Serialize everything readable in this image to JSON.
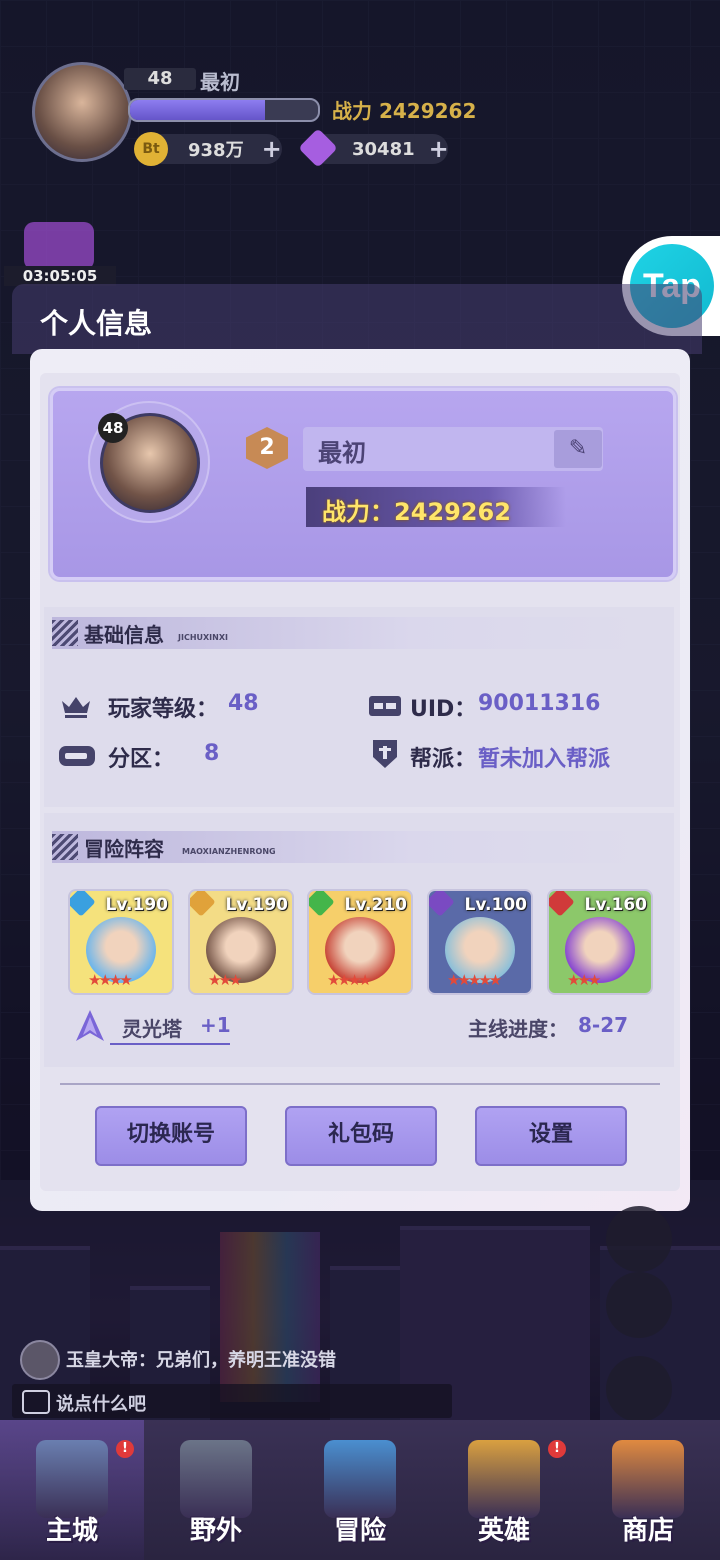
{
  "hud": {
    "level": "48",
    "player_name": "最初",
    "power": "战力 2429262",
    "xp_fraction": 0.72,
    "gold_amount": "938万",
    "gold_icon_text": "Bt",
    "gem_amount": "30481",
    "plus": "+",
    "event_timer": "03:05:05"
  },
  "tap_logo": "Tap",
  "page_title": "个人信息",
  "profile": {
    "level": "48",
    "rank": "2",
    "name": "最初",
    "edit_icon": "pencil-icon",
    "power": "战力：2429262"
  },
  "basic_info": {
    "title": "基础信息",
    "subtitle": "JICHUXINXI",
    "level_label": "玩家等级：",
    "level_value": "48",
    "uid_label": "UID：",
    "uid_value": "90011316",
    "zone_label": "分区：",
    "zone_value": "8",
    "guild_label": "帮派：",
    "guild_value": "暂未加入帮派"
  },
  "lineup": {
    "title": "冒险阵容",
    "subtitle": "MAOXIANZHENRONG",
    "heroes": [
      {
        "level": "Lv.190",
        "stars": "★★★★",
        "element_color": "#3aa0e0",
        "bg": "#f5e27c",
        "face": "#6fb6ea"
      },
      {
        "level": "Lv.190",
        "stars": "★★★",
        "element_color": "#e0a23a",
        "bg": "#f3dc86",
        "face": "#7a5a4c"
      },
      {
        "level": "Lv.210",
        "stars": "★★★★",
        "element_color": "#44b54a",
        "bg": "#f6cf6a",
        "face": "#c8483a"
      },
      {
        "level": "Lv.100",
        "stars": "★★★★★",
        "element_color": "#7a4ac2",
        "bg": "#5a6aa8",
        "face": "#8ec0d8"
      },
      {
        "level": "Lv.160",
        "stars": "★★★",
        "element_color": "#d03a3a",
        "bg": "#8cc86a",
        "face": "#8a4ad0"
      }
    ],
    "tower_label": "灵光塔",
    "tower_value": "+1",
    "progress_label": "主线进度：",
    "progress_value": "8-27"
  },
  "buttons": {
    "switch_account": "切换账号",
    "gift_code": "礼包码",
    "settings": "设置"
  },
  "chat": {
    "message": "玉皇大帝：兄弟们，养明王准没错",
    "placeholder": "说点什么吧"
  },
  "nav": {
    "items": [
      {
        "label": "主城",
        "badge": "!",
        "color": "#6a7fb0"
      },
      {
        "label": "野外",
        "badge": "",
        "color": "#6b7488"
      },
      {
        "label": "冒险",
        "badge": "",
        "color": "#4a8fd0"
      },
      {
        "label": "英雄",
        "badge": "!",
        "color": "#d9a040"
      },
      {
        "label": "商店",
        "badge": "",
        "color": "#e08a40"
      }
    ]
  },
  "colors": {
    "accent": "#6a5fc6",
    "power_gold": "#ffe56a",
    "button": "#a595ee"
  }
}
